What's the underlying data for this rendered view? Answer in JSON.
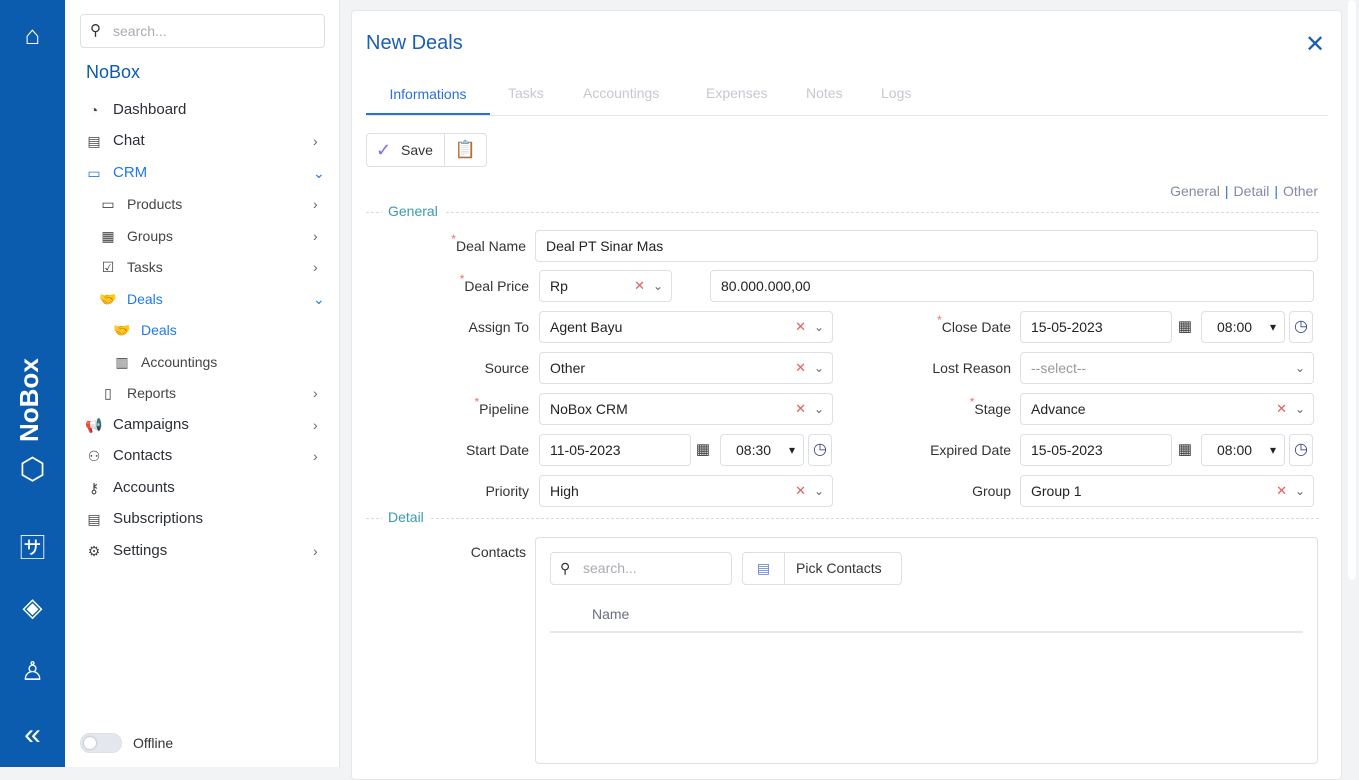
{
  "rail": {
    "brand": "NoBox"
  },
  "sidebar": {
    "search_placeholder": "search...",
    "brand": "NoBox",
    "items": [
      {
        "label": "Dashboard"
      },
      {
        "label": "Chat"
      },
      {
        "label": "CRM"
      },
      {
        "label": "Products"
      },
      {
        "label": "Groups"
      },
      {
        "label": "Tasks"
      },
      {
        "label": "Deals"
      },
      {
        "label": "Deals"
      },
      {
        "label": "Accountings"
      },
      {
        "label": "Reports"
      },
      {
        "label": "Campaigns"
      },
      {
        "label": "Contacts"
      },
      {
        "label": "Accounts"
      },
      {
        "label": "Subscriptions"
      },
      {
        "label": "Settings"
      }
    ],
    "offline_label": "Offline"
  },
  "header": {
    "title": "New Deals"
  },
  "tabs": [
    "Informations",
    "Tasks",
    "Accountings",
    "Expenses",
    "Notes",
    "Logs"
  ],
  "toolbar": {
    "save_label": "Save"
  },
  "anchors": [
    "General",
    "Detail",
    "Other"
  ],
  "sections": {
    "general": "General",
    "detail": "Detail"
  },
  "form": {
    "deal_name": {
      "label": "Deal Name",
      "value": "Deal PT Sinar Mas"
    },
    "deal_price": {
      "label": "Deal Price",
      "currency": "Rp",
      "amount": "80.000.000,00"
    },
    "assign_to": {
      "label": "Assign To",
      "value": "Agent Bayu"
    },
    "source": {
      "label": "Source",
      "value": "Other"
    },
    "pipeline": {
      "label": "Pipeline",
      "value": "NoBox CRM"
    },
    "start_date": {
      "label": "Start Date",
      "date": "11-05-2023",
      "time": "08:30"
    },
    "priority": {
      "label": "Priority",
      "value": "High"
    },
    "close_date": {
      "label": "Close Date",
      "date": "15-05-2023",
      "time": "08:00"
    },
    "lost_reason": {
      "label": "Lost Reason",
      "placeholder": "--select--"
    },
    "stage": {
      "label": "Stage",
      "value": "Advance"
    },
    "expired_date": {
      "label": "Expired Date",
      "date": "15-05-2023",
      "time": "08:00"
    },
    "group": {
      "label": "Group",
      "value": "Group 1"
    }
  },
  "contacts": {
    "label": "Contacts",
    "search_placeholder": "search...",
    "pick_label": "Pick Contacts",
    "columns": [
      "Name"
    ]
  }
}
